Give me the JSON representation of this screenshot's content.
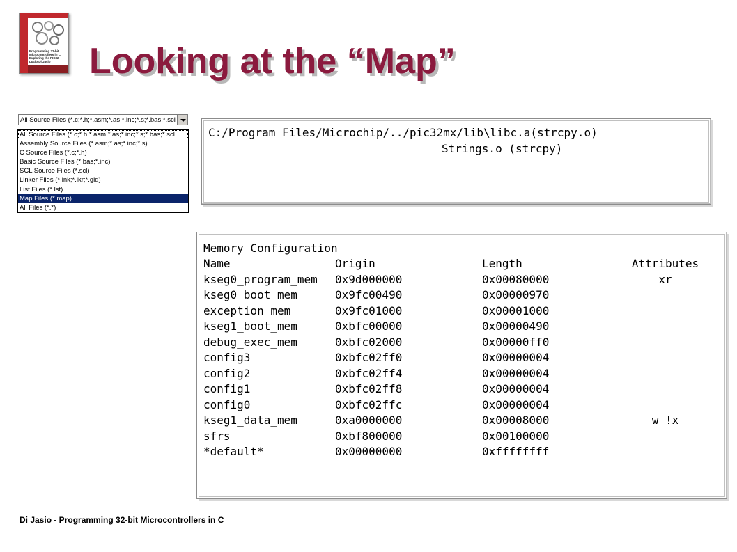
{
  "book": {
    "cover_lines": [
      "Programming 32-bit",
      "Microcontrollers in C",
      "Exploring the PIC32",
      "Lucio Di Jasio"
    ]
  },
  "title": "Looking at the “Map”",
  "file_filter": {
    "selected": "All Source Files (*.c;*.h;*.asm;*.as;*.inc;*.s;*.bas;*.scl",
    "options": [
      "All Source Files (*.c;*.h;*.asm;*.as;*.inc;*.s;*.bas;*.scl",
      "Assembly Source Files (*.asm;*.as;*.inc;*.s)",
      "C Source Files (*.c;*.h)",
      "Basic Source Files (*.bas;*.inc)",
      "SCL Source Files (*.scl)",
      "Linker Files (*.lnk;*.lkr;*.gld)",
      "List Files (*.lst)",
      "Map Files (*.map)",
      "All Files (*.*)"
    ],
    "highlighted_index": 7
  },
  "archive_box": {
    "line1": "C:/Program Files/Microchip/../pic32mx/lib\\libc.a(strcpy.o)",
    "line2": "Strings.o (strcpy)"
  },
  "memory_config": {
    "heading": "Memory Configuration",
    "columns": [
      "Name",
      "Origin",
      "Length",
      "Attributes"
    ],
    "rows": [
      [
        "kseg0_program_mem",
        "0x9d000000",
        "0x00080000",
        "xr"
      ],
      [
        "kseg0_boot_mem",
        "0x9fc00490",
        "0x00000970",
        ""
      ],
      [
        "exception_mem",
        "0x9fc01000",
        "0x00001000",
        ""
      ],
      [
        "kseg1_boot_mem",
        "0xbfc00000",
        "0x00000490",
        ""
      ],
      [
        "debug_exec_mem",
        "0xbfc02000",
        "0x00000ff0",
        ""
      ],
      [
        "config3",
        "0xbfc02ff0",
        "0x00000004",
        ""
      ],
      [
        "config2",
        "0xbfc02ff4",
        "0x00000004",
        ""
      ],
      [
        "config1",
        "0xbfc02ff8",
        "0x00000004",
        ""
      ],
      [
        "config0",
        "0xbfc02ffc",
        "0x00000004",
        ""
      ],
      [
        "kseg1_data_mem",
        "0xa0000000",
        "0x00008000",
        "w !x"
      ],
      [
        "sfrs",
        "0xbf800000",
        "0x00100000",
        ""
      ],
      [
        "*default*",
        "0x00000000",
        "0xffffffff",
        ""
      ]
    ]
  },
  "footer": "Di Jasio - Programming 32-bit Microcontrollers in C",
  "colors": {
    "title": "#8b1a3e",
    "selection": "#0a246a",
    "book_red": "#c0282d"
  }
}
